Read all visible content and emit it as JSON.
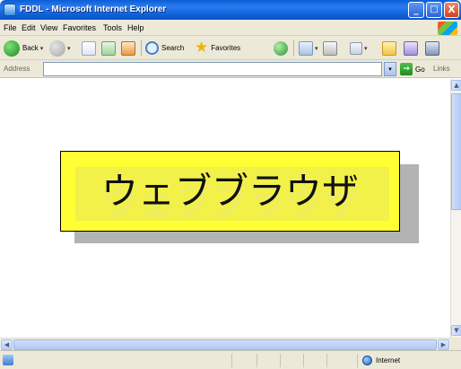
{
  "window": {
    "title": "FDDL - Microsoft Internet Explorer",
    "minimize_glyph": "_",
    "maximize_glyph": "□",
    "close_glyph": "X"
  },
  "menu": [
    {
      "label": "File",
      "mnemonic": "F"
    },
    {
      "label": "Edit",
      "mnemonic": "E"
    },
    {
      "label": "View",
      "mnemonic": "V"
    },
    {
      "label": "Favorites",
      "mnemonic": "a"
    },
    {
      "label": "Tools",
      "mnemonic": "T"
    },
    {
      "label": "Help",
      "mnemonic": "H"
    }
  ],
  "toolbar": {
    "back_label": "Back",
    "search_label": "Search",
    "favorites_label": "Favorites",
    "dropdown_glyph": "▾"
  },
  "address_bar": {
    "label": "Address",
    "value": "",
    "go_label": "Go",
    "links_label": "Links"
  },
  "content": {
    "banner_text": "ウェブブラウザ"
  },
  "status_bar": {
    "text": "",
    "zone_label": "Internet"
  },
  "colors": {
    "titlebar": "#0a5fd6",
    "banner_fill": "#ffff33",
    "banner_shadow": "#b3b3b3",
    "chrome": "#ece9d8"
  }
}
